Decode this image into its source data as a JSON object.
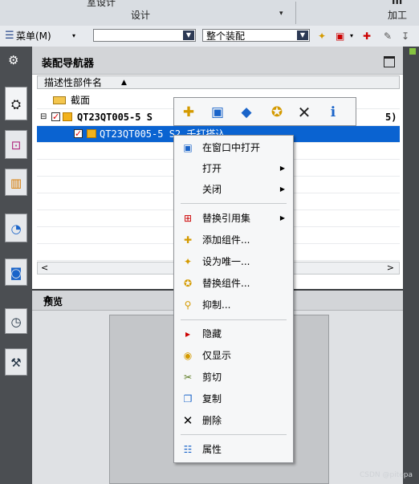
{
  "ribbon": {
    "design_top_partial": "室设计",
    "design": "设计",
    "machining_top_partial": "III",
    "machining": "加工"
  },
  "toolbar": {
    "menu_label": "菜单(M)",
    "filter_value": "",
    "scope_value": "整个装配"
  },
  "navigator": {
    "title": "装配导航器",
    "column_header": "描述性部件名",
    "rows": [
      {
        "label": "截面"
      },
      {
        "label": "QT23QT005-5  S",
        "suffix": "5)"
      },
      {
        "label": "QT23QT005-5  S2_壬打搭込"
      }
    ]
  },
  "preview": {
    "title": "预览"
  },
  "context_menu": {
    "items": [
      {
        "label": "在窗口中打开",
        "icon": "open-in-window-icon"
      },
      {
        "label": "打开",
        "submenu": true
      },
      {
        "label": "关闭",
        "submenu": true
      },
      {
        "label": "替换引用集",
        "icon": "replace-refset-icon",
        "submenu": true
      },
      {
        "label": "添加组件...",
        "icon": "add-component-icon"
      },
      {
        "label": "设为唯一...",
        "icon": "make-unique-icon"
      },
      {
        "label": "替换组件...",
        "icon": "replace-component-icon"
      },
      {
        "label": "抑制...",
        "icon": "suppress-icon"
      },
      {
        "label": "隐藏",
        "icon": "hide-icon"
      },
      {
        "label": "仅显示",
        "icon": "show-only-icon"
      },
      {
        "label": "剪切",
        "icon": "cut-icon"
      },
      {
        "label": "复制",
        "icon": "copy-icon"
      },
      {
        "label": "删除",
        "icon": "delete-icon"
      },
      {
        "label": "属性",
        "icon": "properties-icon"
      }
    ]
  },
  "watermark": "CSDN @pitepa"
}
